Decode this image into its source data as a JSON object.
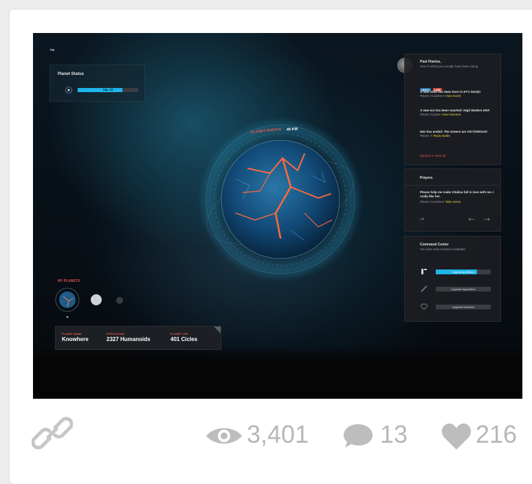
{
  "screen": {
    "logo": "™",
    "planet_status": {
      "title": "Planet Status",
      "bar_label": "S4L 10",
      "progress_percent": 74
    },
    "planet_radius": {
      "label": "PLANET RADIUS",
      "value": "45 KM"
    },
    "feed": {
      "user_name": "Paul Flavius,",
      "greeting": "Here is what your people have been doing",
      "chip_news": "NEWS",
      "chip_live": "LIVE",
      "items": [
        {
          "title": "A new child has been born in ET's family!",
          "sub": "Planet: Knowhere",
          "action": "View Event"
        },
        {
          "title": "A new era has been reached: High Modern ERA",
          "sub": "Planet: Krypton",
          "action": "View Moment"
        },
        {
          "title": "War has ended: The Greens are VICTORIOUS!",
          "sub": "Planet: X",
          "action": "Reply Battle"
        }
      ],
      "expand": "Expand to View all"
    },
    "prayers": {
      "title": "Prayers",
      "text": "Please help me make Vitalina fall in love with me. I really like her.",
      "sub": "Planet: Knowhere",
      "action": "Take action",
      "pager": "1/5"
    },
    "command": {
      "title": "Command Center",
      "subtitle": "You have new research available",
      "buttons": [
        {
          "label": "Upgrading Military",
          "progress_percent": 75
        },
        {
          "label": "Upgrade Agriculture"
        },
        {
          "label": "Upgrade Medicine"
        }
      ]
    },
    "my_planets": "MY PLANETS",
    "info": {
      "name_label": "PLANET NAME",
      "name": "Knowhere",
      "pop_label": "POPULATION",
      "pop": "2327 Humanoids",
      "life_label": "PLANET LIFE",
      "life": "401 Cicles"
    }
  },
  "stats": {
    "views": "3,401",
    "comments": "13",
    "likes": "216"
  },
  "colors": {
    "accent": "#1fb5ea",
    "alert": "#e05a4a",
    "highlight": "#e8d23d",
    "meta": "#b7b7b7"
  },
  "icons": [
    "link-icon",
    "eye-icon",
    "comment-icon",
    "heart-icon",
    "gear-icon",
    "military-icon",
    "agriculture-icon",
    "medicine-icon",
    "arrow-left-icon",
    "arrow-right-icon"
  ]
}
